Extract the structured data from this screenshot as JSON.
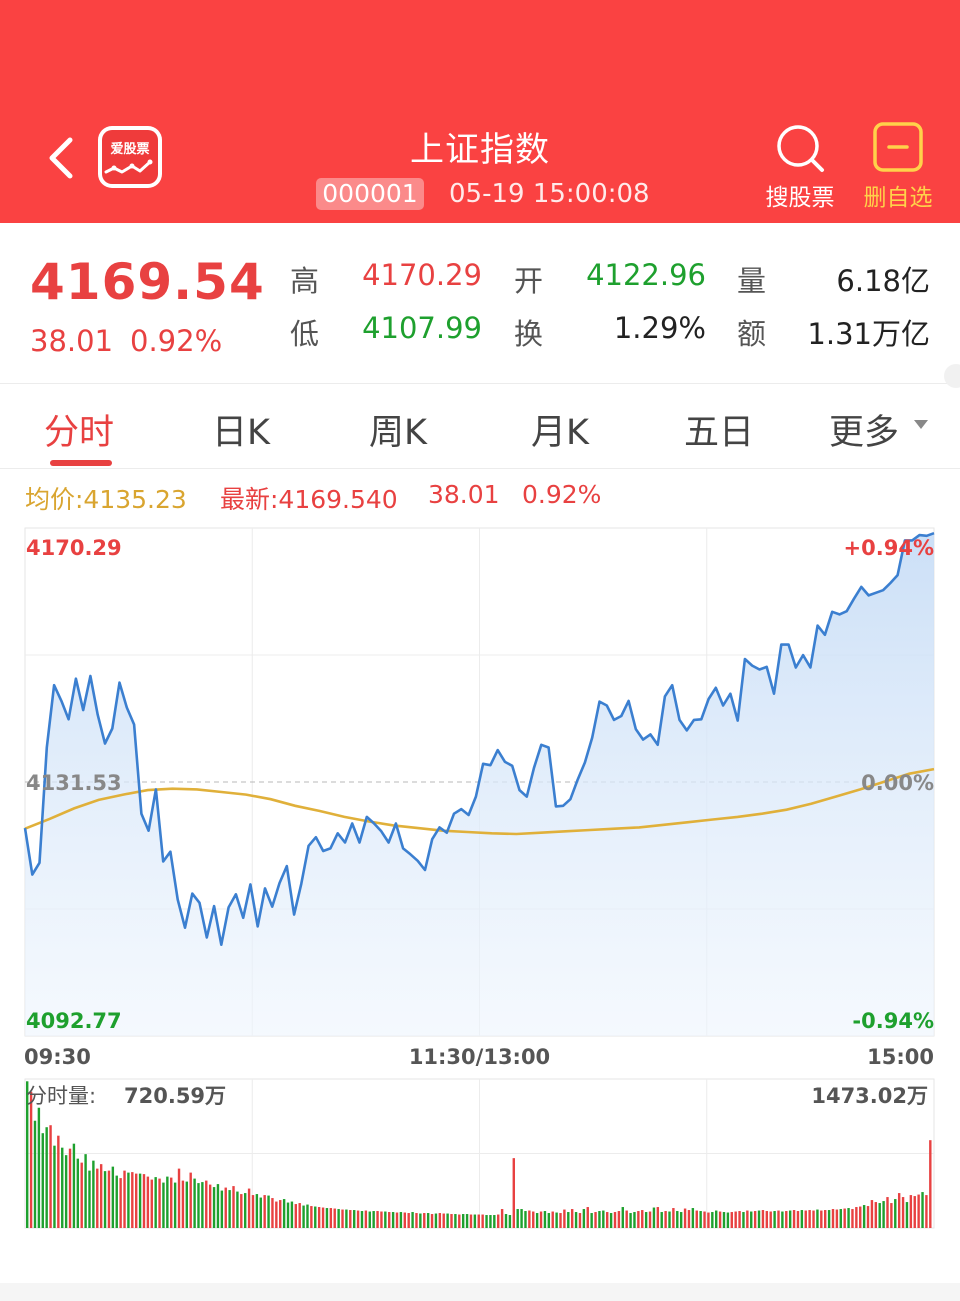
{
  "header": {
    "app_name": "爱股票",
    "title": "上证指数",
    "code": "000001",
    "datetime": "05-19 15:00:08",
    "search_label": "搜股票",
    "remove_fav_label": "删自选",
    "bg_color": "#fa4242"
  },
  "quote": {
    "price": "4169.54",
    "change": "38.01",
    "change_pct": "0.92%",
    "high_label": "高",
    "high": "4170.29",
    "open_label": "开",
    "open": "4122.96",
    "volume_label": "量",
    "volume": "6.18亿",
    "low_label": "低",
    "low": "4107.99",
    "turnover_label": "换",
    "turnover": "1.29%",
    "amount_label": "额",
    "amount": "1.31万亿"
  },
  "tabs": [
    {
      "label": "分时",
      "active": true
    },
    {
      "label": "日K"
    },
    {
      "label": "周K"
    },
    {
      "label": "月K"
    },
    {
      "label": "五日"
    },
    {
      "label": "更多"
    }
  ],
  "info_bar": {
    "avg": "均价:4135.23",
    "latest": "最新:4169.540",
    "change": "38.01",
    "change_pct": "0.92%"
  },
  "chart_data": [
    {
      "type": "line",
      "y_max_label": "4170.29",
      "y_mid_label": "4131.53",
      "y_min_label": "4092.77",
      "pct_top": "+0.94%",
      "pct_mid": "0.00%",
      "pct_bottom": "-0.94%",
      "x_labels": [
        "09:30",
        "11:30/13:00",
        "15:00"
      ],
      "ylim": [
        4092.77,
        4170.29
      ],
      "baseline": 4131.53,
      "colors": {
        "price": "#3b7fd0",
        "avg": "#e0b03a",
        "up": "#e84141",
        "down": "#1ea02e"
      },
      "series": [
        {
          "values": [
            4124.5,
            4117.4,
            4119.2,
            4136.8,
            4146.3,
            4143.9,
            4141.1,
            4147.3,
            4142.5,
            4147.7,
            4141.8,
            4137.4,
            4139.7,
            4146.7,
            4142.9,
            4140.3,
            4126.7,
            4124.1,
            4130.4,
            4119.4,
            4120.9,
            4113.6,
            4109.3,
            4114.5,
            4113.1,
            4107.8,
            4112.6,
            4106.7,
            4112.4,
            4114.4,
            4110.8,
            4115.9,
            4109.5,
            4115.3,
            4112.5,
            4116.1,
            4118.7,
            4111.3,
            4116.0,
            4121.8,
            4123.1,
            4121.0,
            4121.4,
            4123.7,
            4122.3,
            4125.2,
            4122.3,
            4126.2,
            4125.2,
            4124.0,
            4122.3,
            4125.2,
            4121.4,
            4120.5,
            4119.5,
            4118.1,
            4122.8,
            4124.6,
            4123.8,
            4126.7,
            4127.4,
            4126.5,
            4129.3,
            4134.3,
            4134.1,
            4136.4,
            4134.6,
            4134.0,
            4130.3,
            4129.3,
            4133.7,
            4137.2,
            4136.8,
            4127.8,
            4127.9,
            4128.9,
            4131.9,
            4134.5,
            4138.3,
            4143.8,
            4143.2,
            4141.0,
            4141.6,
            4143.9,
            4139.6,
            4138.0,
            4138.8,
            4137.2,
            4144.6,
            4146.3,
            4141.0,
            4139.4,
            4141.0,
            4141.1,
            4144.2,
            4145.9,
            4143.2,
            4145.0,
            4140.9,
            4150.3,
            4149.3,
            4148.7,
            4149.1,
            4145.0,
            4152.5,
            4152.5,
            4149.0,
            4150.9,
            4149.0,
            4155.4,
            4154.0,
            4157.5,
            4157.1,
            4157.6,
            4159.5,
            4161.3,
            4160.0,
            4160.4,
            4160.8,
            4161.9,
            4163.1,
            4168.4,
            4168.4,
            4169.2,
            4169.1,
            4169.5
          ]
        },
        {
          "values": [
            4124.4,
            4125.9,
            4127.5,
            4128.8,
            4129.6,
            4130.3,
            4130.5,
            4130.4,
            4130.0,
            4129.6,
            4128.9,
            4127.9,
            4127.1,
            4126.2,
            4125.5,
            4124.9,
            4124.5,
            4124.1,
            4123.9,
            4123.7,
            4123.6,
            4123.8,
            4124.0,
            4124.2,
            4124.4,
            4124.6,
            4125.0,
            4125.4,
            4125.8,
            4126.2,
            4126.7,
            4127.3,
            4128.2,
            4129.3,
            4130.4,
            4131.6,
            4132.8,
            4133.5
          ]
        }
      ]
    },
    {
      "type": "bar",
      "title": "分时量:",
      "current": "720.59万",
      "max_label": "1473.02万",
      "ylim": [
        0,
        1473.02
      ],
      "values": [
        1470,
        1365,
        1075,
        1205,
        950,
        1010,
        1030,
        825,
        925,
        805,
        730,
        795,
        845,
        695,
        655,
        740,
        575,
        675,
        595,
        640,
        570,
        575,
        615,
        525,
        500,
        575,
        555,
        560,
        545,
        545,
        540,
        515,
        485,
        510,
        495,
        455,
        515,
        505,
        455,
        595,
        475,
        465,
        555,
        495,
        450,
        460,
        475,
        435,
        410,
        440,
        375,
        405,
        380,
        420,
        365,
        340,
        350,
        395,
        330,
        340,
        305,
        330,
        325,
        300,
        265,
        280,
        290,
        255,
        265,
        240,
        250,
        225,
        235,
        220,
        215,
        210,
        205,
        200,
        200,
        195,
        190,
        185,
        185,
        180,
        180,
        175,
        170,
        175,
        165,
        170,
        170,
        165,
        165,
        160,
        160,
        155,
        160,
        155,
        150,
        160,
        150,
        145,
        150,
        150,
        140,
        145,
        150,
        145,
        145,
        140,
        140,
        135,
        140,
        140,
        135,
        135,
        135,
        135,
        130,
        130,
        130,
        135,
        190,
        140,
        130,
        700,
        190,
        190,
        170,
        175,
        165,
        150,
        165,
        170,
        150,
        165,
        155,
        150,
        185,
        160,
        190,
        160,
        150,
        190,
        210,
        150,
        160,
        170,
        175,
        160,
        150,
        160,
        170,
        210,
        175,
        150,
        160,
        170,
        180,
        160,
        165,
        205,
        210,
        160,
        170,
        165,
        200,
        170,
        160,
        195,
        180,
        200,
        175,
        170,
        165,
        155,
        160,
        175,
        165,
        160,
        155,
        160,
        165,
        170,
        160,
        175,
        165,
        170,
        175,
        180,
        170,
        165,
        170,
        175,
        165,
        170,
        175,
        180,
        170,
        180,
        175,
        180,
        175,
        185,
        175,
        180,
        180,
        190,
        185,
        190,
        195,
        200,
        190,
        210,
        215,
        230,
        220,
        280,
        260,
        250,
        270,
        310,
        250,
        290,
        350,
        310,
        260,
        330,
        320,
        335,
        360,
        330,
        880
      ],
      "colors": [
        "d",
        "u",
        "d",
        "d",
        "d",
        "d",
        "u",
        "d",
        "u",
        "d",
        "d",
        "u",
        "d",
        "d",
        "u",
        "d",
        "d",
        "d",
        "u",
        "u",
        "d",
        "u",
        "d",
        "d",
        "u",
        "u",
        "d",
        "u",
        "u",
        "d",
        "u",
        "u",
        "u",
        "d",
        "u",
        "d",
        "d",
        "u",
        "d",
        "u",
        "u",
        "d",
        "u",
        "d",
        "d",
        "d",
        "u",
        "u",
        "d",
        "d",
        "d",
        "u",
        "d",
        "u",
        "d",
        "u",
        "d",
        "u",
        "u",
        "d",
        "d",
        "u",
        "d",
        "u",
        "u",
        "u",
        "d",
        "d",
        "d",
        "u",
        "u",
        "d",
        "d",
        "u",
        "d",
        "u",
        "u",
        "d",
        "u",
        "u",
        "d",
        "u",
        "d",
        "u",
        "d",
        "u",
        "d",
        "u",
        "d",
        "d",
        "u",
        "u",
        "d",
        "u",
        "d",
        "u",
        "d",
        "u",
        "u",
        "d",
        "u",
        "d",
        "u",
        "d",
        "u",
        "d",
        "u",
        "u",
        "d",
        "u",
        "d",
        "u",
        "d",
        "d",
        "u",
        "d",
        "u",
        "u",
        "d",
        "d",
        "d",
        "u",
        "u",
        "d",
        "d",
        "u",
        "d",
        "d",
        "d",
        "u",
        "u",
        "d",
        "u",
        "d",
        "d",
        "u",
        "d",
        "u",
        "u",
        "d",
        "u",
        "d",
        "u",
        "d",
        "u",
        "d",
        "u",
        "d",
        "d",
        "u",
        "d",
        "u",
        "u",
        "d",
        "u",
        "d",
        "d",
        "u",
        "u",
        "d",
        "u",
        "d",
        "u",
        "d",
        "u",
        "d",
        "u",
        "d",
        "d",
        "u",
        "u",
        "d",
        "u",
        "d",
        "u",
        "u",
        "d",
        "d",
        "u",
        "d",
        "d",
        "u",
        "u",
        "u",
        "d",
        "u",
        "d",
        "u",
        "d",
        "u",
        "u",
        "u",
        "d",
        "u",
        "d",
        "u",
        "d",
        "u",
        "u",
        "d",
        "u",
        "u",
        "u",
        "d",
        "u",
        "u",
        "d",
        "u",
        "u",
        "d",
        "u",
        "d",
        "u",
        "u",
        "u",
        "d",
        "u",
        "u",
        "u",
        "d",
        "d",
        "u",
        "u",
        "d",
        "u",
        "u",
        "d",
        "u",
        "u",
        "u",
        "d",
        "u",
        "u",
        "d",
        "u",
        "u",
        "u",
        "u",
        "d",
        "u",
        "d",
        "u"
      ]
    }
  ]
}
